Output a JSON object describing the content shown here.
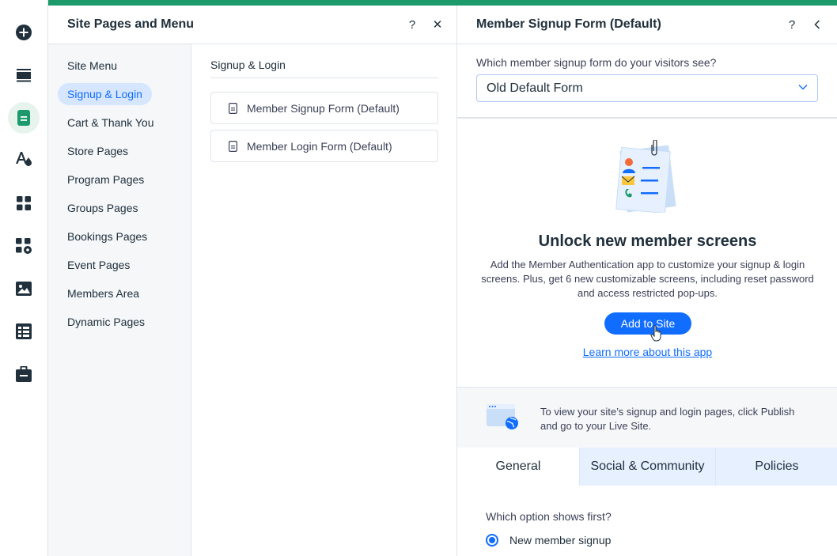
{
  "site_pages": {
    "title": "Site Pages and Menu",
    "help": "?",
    "close": "✕",
    "nav": [
      {
        "label": "Site Menu"
      },
      {
        "label": "Signup & Login",
        "active": true
      },
      {
        "label": "Cart & Thank You"
      },
      {
        "label": "Store Pages"
      },
      {
        "label": "Program Pages"
      },
      {
        "label": "Groups Pages"
      },
      {
        "label": "Bookings Pages"
      },
      {
        "label": "Event Pages"
      },
      {
        "label": "Members Area"
      },
      {
        "label": "Dynamic Pages"
      }
    ],
    "section_title": "Signup & Login",
    "pages": [
      {
        "label": "Member Signup Form (Default)"
      },
      {
        "label": "Member Login Form (Default)"
      }
    ]
  },
  "settings": {
    "title": "Member Signup Form (Default)",
    "help": "?",
    "question": "Which member signup form do your visitors see?",
    "dropdown_value": "Old Default Form",
    "promo_title": "Unlock new member screens",
    "promo_text": "Add the Member Authentication app to customize your signup & login screens. Plus, get 6 new customizable screens, including reset password and access restricted pop-ups.",
    "add_button": "Add to Site",
    "learn_link": "Learn more about this app",
    "info_text": "To view your site’s signup and login pages, click Publish and go to your Live Site.",
    "tabs": [
      {
        "label": "General",
        "active": true
      },
      {
        "label": "Social & Community"
      },
      {
        "label": "Policies"
      }
    ],
    "option_question": "Which option shows first?",
    "option_selected": "New member signup"
  },
  "colors": {
    "accent": "#116dff",
    "brand_green": "#1d9a6c",
    "active_nav_bg": "#d6e6fe"
  },
  "toolbar_icons": [
    "add-icon",
    "sections-icon",
    "pages-icon",
    "design-icon",
    "apps-icon",
    "business-apps-icon",
    "media-icon",
    "cms-icon",
    "portfolio-icon"
  ]
}
